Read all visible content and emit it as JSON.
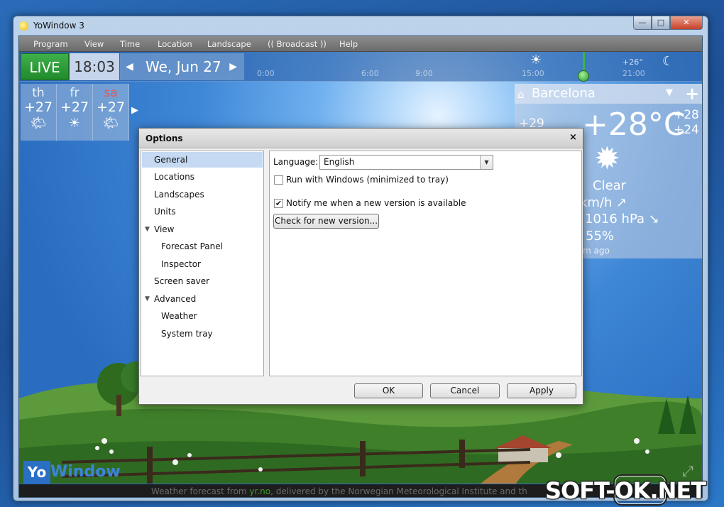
{
  "window": {
    "title": "YoWindow 3",
    "controls": {
      "minimize": "—",
      "maximize": "□",
      "close": "✕"
    }
  },
  "menu": [
    "Program",
    "View",
    "Time",
    "Location",
    "Landscape",
    "(( Broadcast ))",
    "Help"
  ],
  "timebar": {
    "live_label": "LIVE",
    "time": "18:03",
    "date": "We, Jun 27",
    "timeline_labels": [
      "0:00",
      "6:00",
      "9:00",
      "15:00",
      "21:00"
    ],
    "timeline_temp": "+26°",
    "current_time_position": 0.83
  },
  "forecast": [
    {
      "day": "th",
      "temp": "+27",
      "icon": "partly-cloudy-icon"
    },
    {
      "day": "fr",
      "temp": "+27",
      "icon": "sun-icon"
    },
    {
      "day": "sa",
      "temp": "+27",
      "icon": "partly-cloudy-icon"
    }
  ],
  "location": {
    "name": "Barcelona",
    "temp": "+28°C",
    "feels": "+29",
    "high": "+28",
    "low": "+24",
    "condition": "Clear",
    "wind": "km/h ↗",
    "pressure": "1016 hPa ↘",
    "humidity": "55%",
    "updated": "m ago"
  },
  "logo": {
    "part1": "Yo",
    "part2": "Window"
  },
  "bottom": {
    "prefix": "Weather forecast from ",
    "source": "yr.no",
    "suffix": ", delivered by the Norwegian Meteorological Institute and th"
  },
  "dialog": {
    "title": "Options",
    "close": "×",
    "nav": [
      {
        "label": "General",
        "level": 0,
        "selected": true
      },
      {
        "label": "Locations",
        "level": 0
      },
      {
        "label": "Landscapes",
        "level": 0
      },
      {
        "label": "Units",
        "level": 0
      },
      {
        "label": "View",
        "level": 0,
        "expanded": true
      },
      {
        "label": "Forecast Panel",
        "level": 1
      },
      {
        "label": "Inspector",
        "level": 1
      },
      {
        "label": "Screen saver",
        "level": 0
      },
      {
        "label": "Advanced",
        "level": 0,
        "expanded": true
      },
      {
        "label": "Weather",
        "level": 1
      },
      {
        "label": "System tray",
        "level": 1
      }
    ],
    "general": {
      "language_label": "Language:",
      "language_value": "English",
      "run_with_windows": {
        "label": "Run with Windows (minimized to tray)",
        "checked": false
      },
      "notify_new_version": {
        "label": "Notify me when a new version is available",
        "checked": true
      },
      "check_button": "Check for new version..."
    },
    "buttons": {
      "ok": "OK",
      "cancel": "Cancel",
      "apply": "Apply"
    }
  },
  "watermark": "SOFT-OK.NET"
}
